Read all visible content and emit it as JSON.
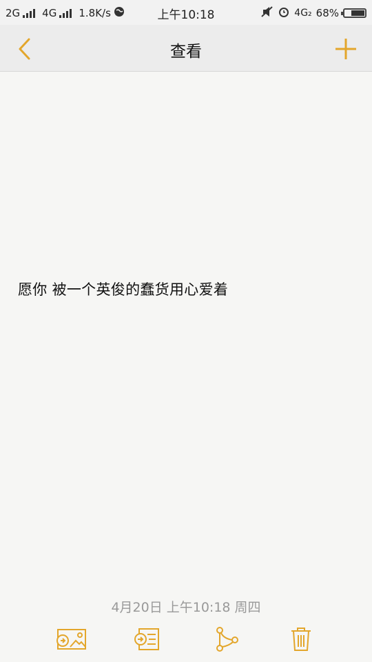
{
  "status_bar": {
    "net1": "2G",
    "net2": "4G",
    "speed": "1.8K/s",
    "time": "上午10:18",
    "net3": "4G₂",
    "battery": "68%",
    "battery_level": 0.68
  },
  "nav": {
    "title": "查看",
    "back_icon": "chevron-left-icon",
    "add_icon": "plus-icon"
  },
  "note": {
    "content": "愿你 被一个英俊的蠢货用心爱着",
    "date": "4月20日 上午10:18 周四"
  },
  "toolbar": {
    "icons": [
      "insert-image-icon",
      "insert-text-icon",
      "share-icon",
      "trash-icon"
    ]
  },
  "colors": {
    "accent": "#e3a62b",
    "background": "#f6f6f4"
  }
}
